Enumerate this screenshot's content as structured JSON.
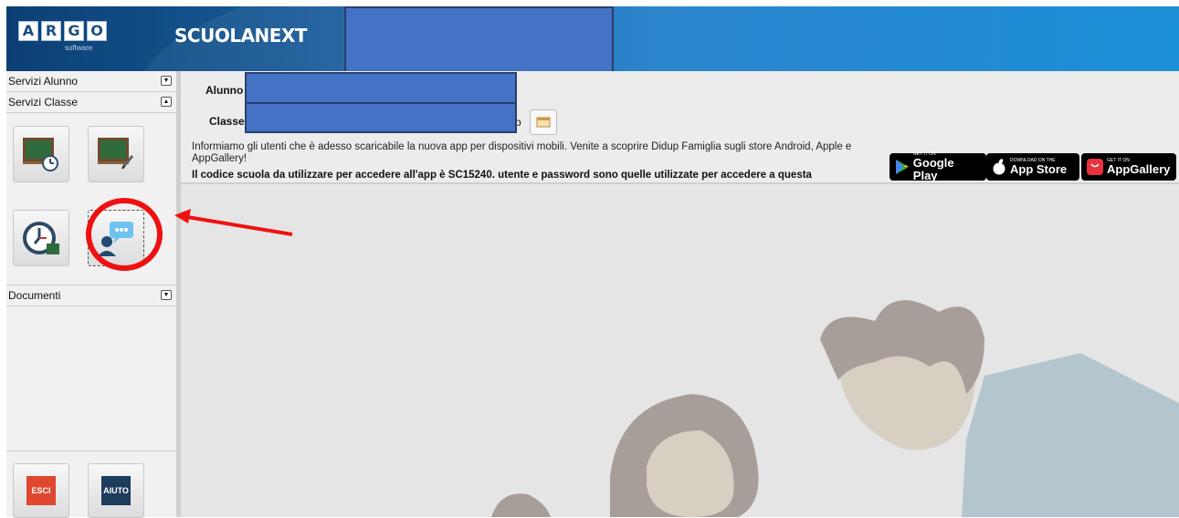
{
  "header": {
    "logo_letters": [
      "A",
      "R",
      "G",
      "O"
    ],
    "logo_sub": "software",
    "brand": "SCUOLANEXT",
    "colors": {
      "start": "#0b3f73",
      "end": "#1c8fd9"
    }
  },
  "sidebar": {
    "sections": [
      {
        "label": "Servizi Alunno",
        "state": "collapsed"
      },
      {
        "label": "Servizi Classe",
        "state": "expanded"
      },
      {
        "label": "Documenti",
        "state": "collapsed"
      }
    ],
    "class_tiles": [
      {
        "icon": "blackboard-clock-icon"
      },
      {
        "icon": "blackboard-pencil-icon"
      },
      {
        "icon": "clock-timetable-icon"
      },
      {
        "icon": "teacher-chat-icon",
        "selected": true
      }
    ],
    "bottom_buttons": [
      {
        "label": "ESCI",
        "color": "#e0472f"
      },
      {
        "label": "AIUTO",
        "color": "#1e3c5c"
      }
    ]
  },
  "main": {
    "alunno_label": "Alunno",
    "classe_label": "Classe",
    "partial_text": "o",
    "notice": "Informiamo gli utenti che è adesso scaricabile la nuova app per dispositivi mobili. Venite a scoprire Didup Famiglia sugli store Android, Apple e AppGallery!",
    "notice_bold": "Il codice scuola da utilizzare per accedere all'app è SC15240. utente e password sono quelle utilizzate per accedere a questa",
    "stores": [
      {
        "small": "GET IT ON",
        "big": "Google Play"
      },
      {
        "small": "DOWNLOAD ON THE",
        "big": "App Store"
      },
      {
        "small": "GET IT ON",
        "big": "AppGallery"
      }
    ]
  }
}
